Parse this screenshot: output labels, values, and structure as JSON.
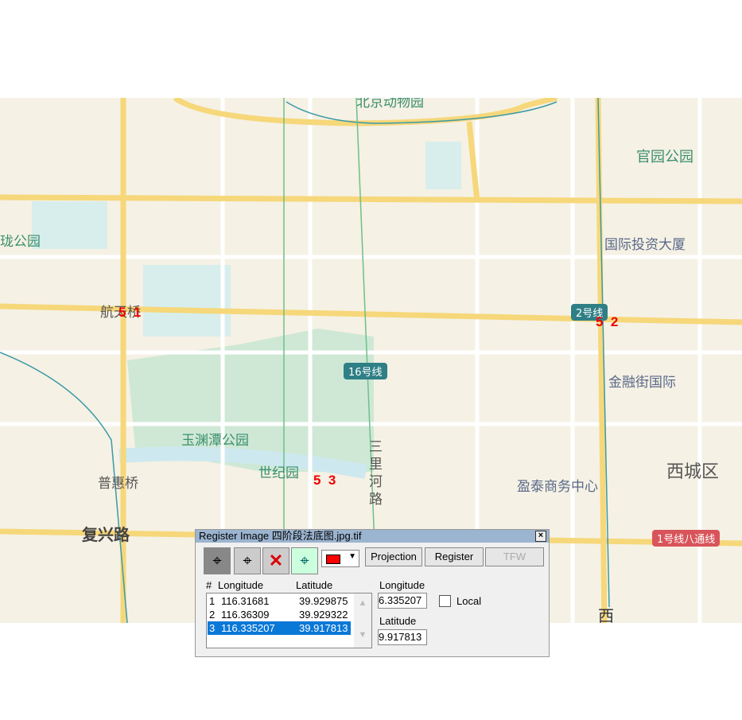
{
  "map": {
    "labels": {
      "zoo": "北京动物园",
      "guanyuan": "官园公园",
      "park_left": "珑公园",
      "intl": "国际投资大厦",
      "hangtian": "航天桥",
      "line2": "2号线",
      "line16": "16号线",
      "jinrong": "金融街国际",
      "yuyuantan": "玉渊潭公园",
      "shijiyuan": "世纪园",
      "sanlihe": "三里河路",
      "xicheng": "西城区",
      "yingtai": "盈泰商务中心",
      "puhui": "普惠桥",
      "fuxing": "复兴路",
      "line1": "1号线八通线",
      "xi": "西"
    },
    "markers": [
      {
        "a": "5",
        "b": "1"
      },
      {
        "a": "5",
        "b": "2"
      },
      {
        "a": "5",
        "b": "3"
      }
    ]
  },
  "dialog": {
    "title": "Register Image 四阶段法底图.jpg.tif",
    "tools": [
      "point-tool",
      "move-point-tool",
      "delete-point-tool",
      "map-point-tool"
    ],
    "marker_color": "#ff0000",
    "buttons": {
      "projection": "Projection",
      "register": "Register",
      "tfw": "TFW"
    },
    "list_headers": {
      "num": "#",
      "lon": "Longitude",
      "lat": "Latitude"
    },
    "rows": [
      {
        "n": "1",
        "lon": "116.31681",
        "lat": "39.929875"
      },
      {
        "n": "2",
        "lon": "116.36309",
        "lat": "39.929322"
      },
      {
        "n": "3",
        "lon": "116.335207",
        "lat": "39.917813",
        "selected": true
      }
    ],
    "lon_label": "Longitude",
    "lon_value": "6.335207",
    "lat_label": "Latitude",
    "lat_value": "9.917813",
    "local_label": "Local",
    "local_checked": false
  }
}
